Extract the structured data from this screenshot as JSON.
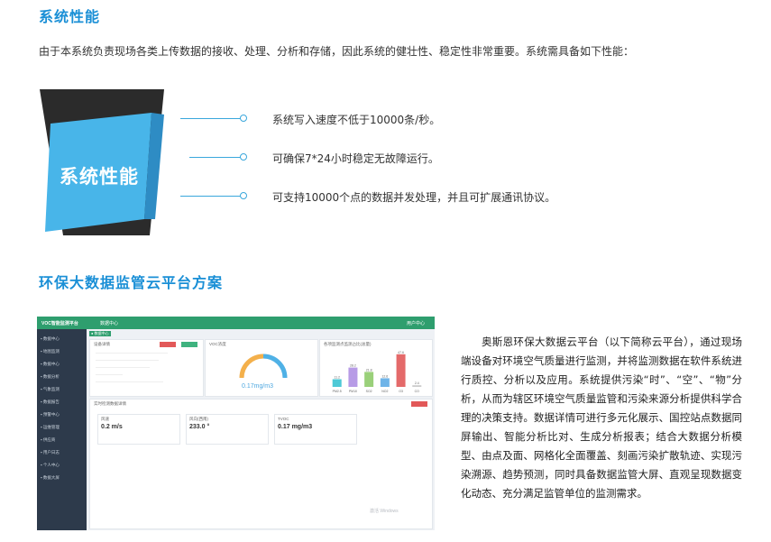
{
  "section1": {
    "title": "系统性能",
    "intro": "由于本系统负责现场各类上传数据的接收、处理、分析和存储，因此系统的健壮性、稳定性非常重要。系统需具备如下性能：",
    "badge": "系统性能",
    "features": [
      "系统写入速度不低于10000条/秒。",
      "可确保7*24小时稳定无故障运行。",
      "可支持10000个点的数据并发处理，并且可扩展通讯协议。"
    ]
  },
  "section2": {
    "title": "环保大数据监管云平台方案",
    "description": "奥斯恩环保大数据云平台（以下简称云平台），通过现场端设备对环境空气质量进行监测，并将监测数据在软件系统进行质控、分析以及应用。系统提供污染“时”、“空”、“物”分析，从而为辖区环境空气质量监管和污染来源分析提供科学合理的决策支持。数据详情可进行多元化展示、国控站点数据同屏输出、智能分析比对、生成分析报表；结合大数据分析模型、由点及面、网格化全面覆盖、刻画污染扩散轨迹、实现污染溯源、趋势预测，同时具备数据监管大屏、直观呈现数据变化动态、充分满足监管单位的监测需求。"
  },
  "dashboard": {
    "app_title": "VOC智能监测平台",
    "nav_title": "数据中心",
    "user": "用户中心",
    "tab": "● 数据中心",
    "sidebar": [
      "数据中心",
      "地图监测",
      "数据中心",
      "数据分析",
      "气象监测",
      "数据报告",
      "预警中心",
      "运维管理",
      "供应商",
      "用户日志",
      "个人中心",
      "数据大屏"
    ],
    "card1_title": "设备详情",
    "card2_title": "VOC浓度",
    "gauge_value": "0.17mg/m3",
    "card3_title": "各项监测点监测占比(总量)",
    "card4_title": "实时检测数据详情",
    "metrics": [
      {
        "label": "风速",
        "value": "0.2",
        "unit": "m/s"
      },
      {
        "label": "风向(西南)",
        "value": "233.0",
        "unit": "°"
      },
      {
        "label": "TVOC",
        "value": "0.17",
        "unit": "mg/m3"
      }
    ],
    "watermark": "激活 Windows",
    "chart_data": {
      "type": "bar",
      "categories": [
        "PM2.5",
        "PM10",
        "SO2",
        "NO2",
        "O3",
        "CO"
      ],
      "values": [
        11.2,
        28.2,
        21.8,
        12.6,
        47.6,
        2.4
      ],
      "colors": [
        "#4ec9d6",
        "#b79be6",
        "#9ad07a",
        "#6fb4e8",
        "#e46a6a",
        "#cccccc"
      ],
      "ylim": [
        0,
        50
      ]
    }
  },
  "colors": {
    "accent": "#1a8fd6",
    "badge": "#48b5e9",
    "dark": "#2b2b2b"
  }
}
